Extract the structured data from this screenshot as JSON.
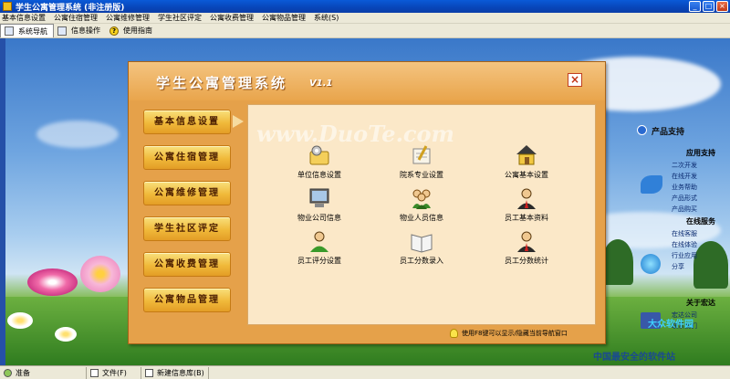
{
  "window": {
    "title": "学生公寓管理系统 (非注册版)",
    "controls": [
      "_",
      "□",
      "×"
    ]
  },
  "menu": [
    "基本信息设置",
    "公寓住宿管理",
    "公寓维修管理",
    "学生社区评定",
    "公寓收费管理",
    "公寓物品管理",
    "系统(S)"
  ],
  "toolbar": [
    {
      "label": "系统导航",
      "icon": "monitor-icon"
    },
    {
      "label": "信息操作",
      "icon": "window-icon"
    },
    {
      "label": "使用指南",
      "icon": "help-icon"
    }
  ],
  "dialog": {
    "title": "学生公寓管理系统",
    "version": "V1.1",
    "close_label": "×",
    "nav": [
      "基本信息设置",
      "公寓住宿管理",
      "公寓维修管理",
      "学生社区评定",
      "公寓收费管理",
      "公寓物品管理"
    ],
    "tiles": [
      {
        "label": "单位信息设置",
        "icon": "gear-folder-icon"
      },
      {
        "label": "院系专业设置",
        "icon": "edit-book-icon"
      },
      {
        "label": "公寓基本设置",
        "icon": "house-icon"
      },
      {
        "label": "物业公司信息",
        "icon": "computer-icon"
      },
      {
        "label": "物业人员信息",
        "icon": "group-icon"
      },
      {
        "label": "员工基本资料",
        "icon": "user-tie-icon"
      },
      {
        "label": "员工评分设置",
        "icon": "user-icon"
      },
      {
        "label": "员工分数录入",
        "icon": "open-book-icon"
      },
      {
        "label": "员工分数统计",
        "icon": "user-tie-icon"
      }
    ],
    "hint": "使用F8键可以显示/隐藏当前导航窗口",
    "watermark": "www.DuoTe.com"
  },
  "side_panel": {
    "title": "产品支持",
    "section1": "应用支持",
    "items1": [
      "二次开发",
      "在线开发",
      "业务帮助",
      "产品形式",
      "产品购买"
    ],
    "section2": "在线服务",
    "items2": [
      "在线客服",
      "在线体验",
      "行业应用",
      "分享"
    ],
    "section3": "关于宏达",
    "items3": [
      "宏达公司",
      "联系我们"
    ]
  },
  "status": [
    "准备",
    "文件(F)",
    "新建信息库(B)"
  ],
  "corner_watermark": {
    "line1": "大众软件园",
    "line2": "中国最安全的软件站"
  }
}
